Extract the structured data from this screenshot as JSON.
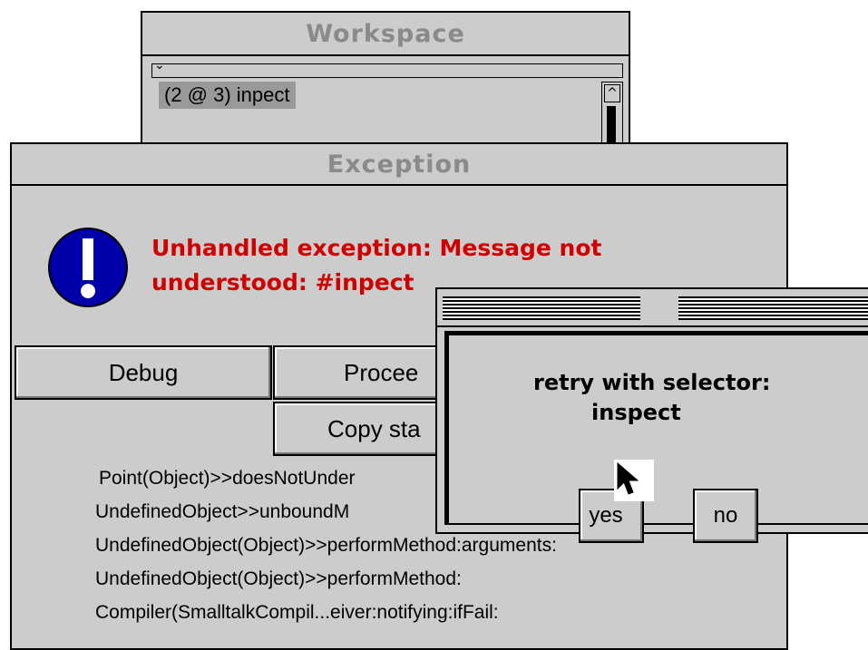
{
  "workspace": {
    "title": "Workspace",
    "collapse_arrow": "⌄",
    "code": "(2 @ 3) inpect",
    "scroll_up": "^"
  },
  "exception": {
    "title": "Exception",
    "message_line1": "Unhandled exception: Message not",
    "message_line2": "understood: #inpect",
    "buttons": {
      "debug": "Debug",
      "proceed": "Procee",
      "copy_stack": "Copy sta"
    },
    "stack": [
      "Point(Object)>>doesNotUnder",
      "UndefinedObject>>unboundM",
      "UndefinedObject(Object)>>performMethod:arguments:",
      "UndefinedObject(Object)>>performMethod:",
      "Compiler(SmalltalkCompil...eiver:notifying:ifFail:"
    ],
    "icon": "exclamation-icon"
  },
  "retry_dialog": {
    "prompt": "retry with selector:",
    "selector": "inspect",
    "yes_label": "yes",
    "no_label": "no"
  },
  "colors": {
    "error_text": "#d00000",
    "icon_blue": "#0000aa",
    "window_bg": "#cccccc",
    "title_text": "#8a8a8a"
  }
}
